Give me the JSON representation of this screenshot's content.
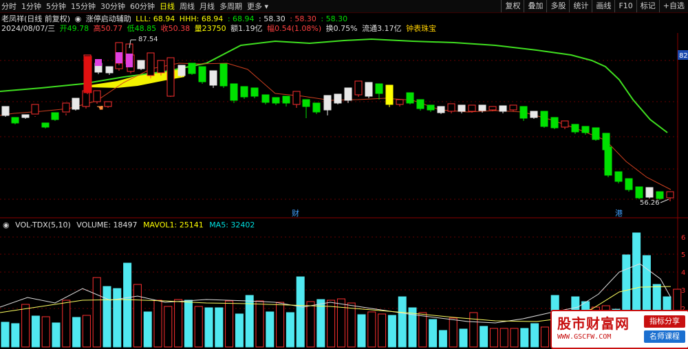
{
  "toolbar": {
    "periods": [
      "分时",
      "1分钟",
      "5分钟",
      "15分钟",
      "30分钟",
      "60分钟",
      "日线",
      "周线",
      "月线",
      "多周期",
      "更多"
    ],
    "active_period": "日线",
    "actions": [
      "复权",
      "叠加",
      "多股",
      "统计",
      "画线",
      "F10",
      "标记",
      "+自选"
    ]
  },
  "header": {
    "stock_name": "老凤祥(日线 前复权)",
    "indicator": "涨停启动辅助",
    "lll_label": "LLL: 68.94",
    "hhh_label": "HHH: 68.94",
    "v1": ": 68.94",
    "v2": ": 58.30",
    "v3": ": 58.30",
    "v4": ": 58.30"
  },
  "info": {
    "date": "2024/08/07/三",
    "open": "开49.78",
    "high": "高50.77",
    "low": "低48.85",
    "close": "收50.38",
    "vol": "量23750",
    "amount": "额1.19亿",
    "change": "幅0.54(1.08%)",
    "turnover": "换0.75%",
    "float": "流通3.17亿",
    "sector": "钟表珠宝"
  },
  "price_axis": {
    "top_label": "82"
  },
  "annotations": {
    "high_price": "87.54",
    "low_price": "56.26",
    "marker_cai": "财",
    "marker_gang": "港"
  },
  "volume": {
    "title": "VOL-TDX(5,10)",
    "volume": "VOLUME: 18497",
    "mavol1": "MAVOL1: 25141",
    "ma5": "MA5: 32402",
    "axis": [
      "6",
      "5",
      "4",
      "3",
      "2"
    ]
  },
  "colors": {
    "up": "#ff3030",
    "down": "#00e000",
    "vol_down": "#50e8f0",
    "ma": "#ffff60",
    "long_ma": "#40e020"
  },
  "watermark": {
    "title": "股市财富网",
    "url": "WWW.GSCFW.COM",
    "btn1": "指标分享",
    "btn2": "名师课程"
  },
  "chart_data": {
    "type": "candlestick",
    "candles": [
      [
        "w",
        159,
        155,
        168,
        170
      ],
      [
        "d",
        173,
        171,
        179,
        181
      ],
      [
        "w",
        169,
        167,
        171,
        173
      ],
      [
        "u",
        169,
        152,
        166,
        170
      ],
      [
        "d",
        182,
        179,
        185,
        187
      ],
      [
        "d",
        166,
        164,
        174,
        176
      ],
      [
        "u",
        165,
        150,
        163,
        168
      ],
      [
        "w",
        154,
        143,
        159,
        161
      ],
      [
        "u",
        143,
        132,
        155,
        158
      ],
      [
        "u",
        135,
        132,
        148,
        151
      ],
      [
        "u",
        82,
        80,
        135,
        137
      ],
      [
        "u",
        151,
        148,
        155,
        157
      ],
      [
        "w",
        96,
        92,
        105,
        108
      ],
      [
        "u",
        82,
        76,
        100,
        103
      ],
      [
        "w",
        99,
        97,
        106,
        109
      ],
      [
        "u",
        74,
        64,
        93,
        96
      ],
      [
        "u",
        78,
        62,
        92,
        95
      ],
      [
        "w",
        96,
        88,
        100,
        102
      ],
      [
        "u",
        96,
        80,
        104,
        107
      ],
      [
        "u",
        89,
        77,
        110,
        114
      ],
      [
        "u",
        96,
        88,
        106,
        110
      ],
      [
        "u",
        85,
        84,
        140,
        141
      ],
      [
        "w",
        98,
        95,
        110,
        112
      ],
      [
        "d",
        93,
        92,
        107,
        109
      ],
      [
        "d",
        109,
        97,
        119,
        122
      ],
      [
        "w",
        107,
        103,
        124,
        128
      ],
      [
        "d",
        95,
        93,
        125,
        128
      ],
      [
        "d",
        126,
        122,
        146,
        150
      ],
      [
        "d",
        127,
        126,
        141,
        144
      ],
      [
        "d",
        131,
        128,
        140,
        143
      ],
      [
        "d",
        141,
        138,
        149,
        152
      ],
      [
        "d",
        144,
        142,
        150,
        153
      ],
      [
        "d",
        145,
        140,
        150,
        155
      ],
      [
        "u",
        141,
        133,
        152,
        157
      ],
      [
        "d",
        147,
        145,
        155,
        172
      ],
      [
        "d",
        153,
        150,
        163,
        166
      ],
      [
        "w",
        147,
        139,
        160,
        168
      ],
      [
        "w",
        141,
        137,
        150,
        152
      ],
      [
        "w",
        133,
        128,
        146,
        150
      ],
      [
        "u",
        125,
        118,
        138,
        141
      ],
      [
        "w",
        124,
        120,
        140,
        143
      ],
      [
        "d",
        125,
        122,
        136,
        145
      ],
      [
        "y",
        130,
        124,
        152,
        156
      ],
      [
        "u",
        151,
        145,
        152,
        155
      ],
      [
        "d",
        138,
        135,
        150,
        152
      ],
      [
        "d",
        148,
        145,
        158,
        161
      ],
      [
        "d",
        155,
        153,
        160,
        163
      ],
      [
        "w",
        159,
        155,
        164,
        166
      ],
      [
        "u",
        155,
        151,
        162,
        165
      ],
      [
        "w",
        157,
        153,
        162,
        165
      ],
      [
        "u",
        157,
        153,
        162,
        164
      ],
      [
        "w",
        157,
        153,
        161,
        164
      ],
      [
        "u",
        157,
        155,
        160,
        162
      ],
      [
        "w",
        157,
        154,
        162,
        165
      ],
      [
        "u",
        157,
        153,
        160,
        162
      ],
      [
        "d",
        157,
        155,
        172,
        176
      ],
      [
        "w",
        166,
        162,
        171,
        173
      ],
      [
        "d",
        164,
        162,
        184,
        186
      ],
      [
        "d",
        174,
        171,
        186,
        188
      ],
      [
        "u",
        178,
        176,
        185,
        188
      ],
      [
        "d",
        182,
        181,
        192,
        195
      ],
      [
        "d",
        186,
        184,
        193,
        196
      ],
      [
        "d",
        188,
        186,
        203,
        205
      ],
      [
        "d",
        198,
        194,
        218,
        220
      ],
      [
        "d",
        216,
        214,
        255,
        258
      ],
      [
        "d",
        254,
        250,
        264,
        267
      ],
      [
        "d",
        263,
        260,
        276,
        279
      ],
      [
        "d",
        274,
        272,
        288,
        290
      ],
      [
        "w",
        280,
        273,
        287,
        289
      ],
      [
        "d",
        281,
        279,
        289,
        291
      ],
      [
        "u",
        286,
        279,
        288,
        293
      ]
    ],
    "ma_short": [
      [
        0,
        168
      ],
      [
        20,
        165
      ],
      [
        60,
        162
      ],
      [
        100,
        158
      ],
      [
        140,
        147
      ],
      [
        180,
        120
      ],
      [
        220,
        100
      ],
      [
        260,
        92
      ],
      [
        290,
        93
      ],
      [
        330,
        92
      ],
      [
        360,
        101
      ],
      [
        400,
        136
      ],
      [
        440,
        140
      ],
      [
        480,
        146
      ],
      [
        520,
        145
      ],
      [
        560,
        143
      ],
      [
        600,
        146
      ],
      [
        640,
        160
      ],
      [
        680,
        163
      ],
      [
        720,
        161
      ],
      [
        760,
        163
      ],
      [
        800,
        174
      ],
      [
        840,
        188
      ],
      [
        880,
        204
      ],
      [
        910,
        235
      ],
      [
        940,
        258
      ],
      [
        975,
        276
      ]
    ],
    "ma_long": [
      [
        0,
        133
      ],
      [
        60,
        128
      ],
      [
        120,
        122
      ],
      [
        180,
        112
      ],
      [
        240,
        104
      ],
      [
        300,
        92
      ],
      [
        350,
        66
      ],
      [
        400,
        60
      ],
      [
        450,
        63
      ],
      [
        500,
        59
      ],
      [
        540,
        57
      ],
      [
        600,
        60
      ],
      [
        660,
        62
      ],
      [
        720,
        66
      ],
      [
        780,
        73
      ],
      [
        830,
        80
      ],
      [
        860,
        88
      ],
      [
        880,
        97
      ],
      [
        900,
        116
      ],
      [
        920,
        145
      ],
      [
        945,
        174
      ],
      [
        970,
        193
      ]
    ],
    "volumes": [
      [
        "d",
        469,
        505
      ],
      [
        "d",
        471,
        505
      ],
      [
        "u",
        443,
        505
      ],
      [
        "d",
        460,
        505
      ],
      [
        "u",
        461,
        505
      ],
      [
        "d",
        470,
        505
      ],
      [
        "u",
        437,
        505
      ],
      [
        "d",
        462,
        505
      ],
      [
        "u",
        459,
        505
      ],
      [
        "u",
        404,
        505
      ],
      [
        "d",
        417,
        505
      ],
      [
        "d",
        420,
        505
      ],
      [
        "d",
        383,
        505
      ],
      [
        "u",
        414,
        505
      ],
      [
        "d",
        454,
        505
      ],
      [
        "u",
        437,
        505
      ],
      [
        "u",
        446,
        505
      ],
      [
        "u",
        436,
        505
      ],
      [
        "d",
        437,
        505
      ],
      [
        "u",
        446,
        505
      ],
      [
        "d",
        448,
        505
      ],
      [
        "d",
        448,
        505
      ],
      [
        "u",
        438,
        505
      ],
      [
        "d",
        457,
        505
      ],
      [
        "d",
        430,
        505
      ],
      [
        "u",
        438,
        505
      ],
      [
        "d",
        454,
        505
      ],
      [
        "u",
        440,
        505
      ],
      [
        "d",
        455,
        505
      ],
      [
        "d",
        403,
        505
      ],
      [
        "u",
        439,
        505
      ],
      [
        "d",
        436,
        505
      ],
      [
        "u",
        437,
        505
      ],
      [
        "u",
        435,
        505
      ],
      [
        "u",
        441,
        505
      ],
      [
        "d",
        458,
        505
      ],
      [
        "u",
        454,
        505
      ],
      [
        "u",
        457,
        505
      ],
      [
        "d",
        459,
        505
      ],
      [
        "d",
        432,
        505
      ],
      [
        "d",
        448,
        505
      ],
      [
        "u",
        455,
        505
      ],
      [
        "d",
        465,
        505
      ],
      [
        "d",
        481,
        505
      ],
      [
        "u",
        463,
        505
      ],
      [
        "d",
        479,
        505
      ],
      [
        "u",
        455,
        505
      ],
      [
        "d",
        475,
        505
      ],
      [
        "u",
        478,
        505
      ],
      [
        "u",
        478,
        505
      ],
      [
        "u",
        478,
        505
      ],
      [
        "d",
        478,
        505
      ],
      [
        "d",
        471,
        505
      ],
      [
        "u",
        476,
        505
      ],
      [
        "d",
        430,
        505
      ],
      [
        "d",
        472,
        505
      ],
      [
        "d",
        432,
        505
      ],
      [
        "d",
        439,
        505
      ],
      [
        "u",
        447,
        505
      ],
      [
        "u",
        445,
        505
      ],
      [
        "d",
        450,
        505
      ],
      [
        "d",
        371,
        505
      ],
      [
        "d",
        339,
        505
      ],
      [
        "d",
        372,
        505
      ],
      [
        "d",
        414,
        505
      ],
      [
        "d",
        432,
        505
      ],
      [
        "u",
        421,
        505
      ]
    ],
    "vol_ma_short": [
      [
        0,
        447
      ],
      [
        40,
        433
      ],
      [
        80,
        441
      ],
      [
        120,
        420
      ],
      [
        160,
        437
      ],
      [
        200,
        431
      ],
      [
        240,
        440
      ],
      [
        300,
        436
      ],
      [
        360,
        438
      ],
      [
        400,
        440
      ],
      [
        440,
        447
      ],
      [
        480,
        440
      ],
      [
        520,
        446
      ],
      [
        560,
        452
      ],
      [
        600,
        458
      ],
      [
        640,
        463
      ],
      [
        680,
        468
      ],
      [
        720,
        470
      ],
      [
        760,
        464
      ],
      [
        800,
        455
      ],
      [
        840,
        447
      ],
      [
        870,
        428
      ],
      [
        900,
        396
      ],
      [
        930,
        384
      ],
      [
        960,
        406
      ],
      [
        975,
        433
      ]
    ],
    "vol_ma_long": [
      [
        0,
        455
      ],
      [
        60,
        446
      ],
      [
        120,
        437
      ],
      [
        180,
        436
      ],
      [
        240,
        438
      ],
      [
        300,
        441
      ],
      [
        360,
        442
      ],
      [
        420,
        444
      ],
      [
        480,
        446
      ],
      [
        540,
        451
      ],
      [
        600,
        456
      ],
      [
        660,
        462
      ],
      [
        720,
        467
      ],
      [
        780,
        468
      ],
      [
        820,
        463
      ],
      [
        860,
        450
      ],
      [
        900,
        425
      ],
      [
        930,
        418
      ],
      [
        975,
        417
      ]
    ]
  }
}
